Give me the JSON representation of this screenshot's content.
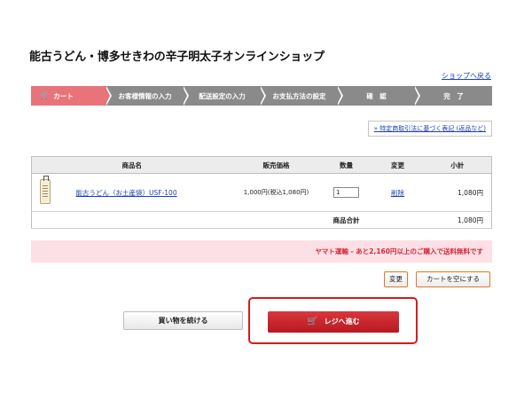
{
  "header": {
    "shop_title": "能古うどん・博多せきわの辛子明太子オンラインショップ",
    "back_link": "ショップへ戻る"
  },
  "steps": [
    {
      "label": "カート",
      "active": true,
      "icon": "cart-icon"
    },
    {
      "label": "お客様情報の入力",
      "active": false
    },
    {
      "label": "配送設定の入力",
      "active": false
    },
    {
      "label": "お支払方法の設定",
      "active": false
    },
    {
      "label": "確　認",
      "active": false
    },
    {
      "label": "完　了",
      "active": false
    }
  ],
  "law_link": "» 特定商取引法に基づく表記 (返品など)",
  "table": {
    "headers": [
      "商品名",
      "販売価格",
      "数量",
      "変更",
      "小計"
    ],
    "items": [
      {
        "image_icon": "product-bag-icon",
        "name": "能古うどん（お土産袋）USF-100",
        "price": "1,000円(税込1,080円)",
        "quantity": "1",
        "edit": "削除",
        "subtotal": "1,080円"
      }
    ],
    "total_label": "商品合計",
    "total_value": "1,080円"
  },
  "shipping_notice": "ヤマト運輸 - あと2,160円以上のご購入で送料無料です",
  "buttons": {
    "change": "変更",
    "empty_cart": "カートを空にする",
    "continue_shopping": "買い物を続ける",
    "checkout": "レジへ進む"
  },
  "colors": {
    "accent": "#d42a3e",
    "active_step": "#e8747a",
    "highlight": "#d41c1c"
  }
}
